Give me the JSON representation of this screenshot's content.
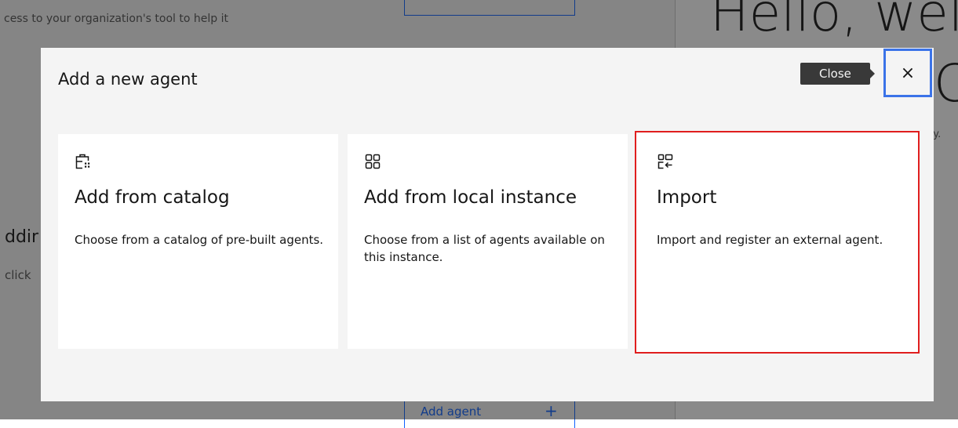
{
  "background": {
    "intro_text": "cess to your organization's tool to help it",
    "greeting_line1": "Hello, wel",
    "greeting_line2": "C",
    "side_text": "ary.",
    "left_title": "ddir",
    "left_sub": "click",
    "add_agent_label": "Add agent",
    "add_agent_plus": "+"
  },
  "modal": {
    "title": "Add a new agent",
    "close_tooltip": "Close",
    "close_glyph": "×",
    "cards": [
      {
        "title": "Add from catalog",
        "description": "Choose from a catalog of pre-built agents.",
        "icon": "catalog-icon"
      },
      {
        "title": "Add from local instance",
        "description": "Choose from a list of agents available on this instance.",
        "icon": "grid-icon"
      },
      {
        "title": "Import",
        "description": "Import and register an external agent.",
        "icon": "import-icon"
      }
    ]
  },
  "colors": {
    "highlight_red": "#e01e1e",
    "focus_blue": "#3b73e8",
    "tooltip_bg": "#393939",
    "overlay": "rgba(22,22,22,0.5)"
  }
}
